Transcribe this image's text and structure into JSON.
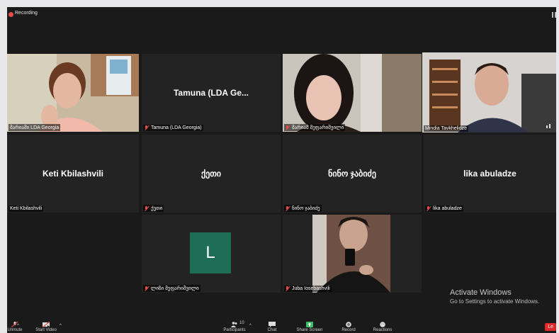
{
  "recording": {
    "label": "Recording"
  },
  "tiles": [
    {
      "id": "t1",
      "label": "მარიამი LDA Georgia",
      "muted": false
    },
    {
      "id": "t2",
      "center_name": "Tamuna  (LDA Ge...",
      "label": "Tamuna (LDA Georgia)",
      "muted": true
    },
    {
      "id": "t3",
      "label": "მარიამ მეფარიშვილი",
      "muted": true
    },
    {
      "id": "t4",
      "label": "Mindia Tavkhelidze",
      "muted": false,
      "active_speaker": true
    },
    {
      "id": "t5",
      "center_name": "Keti Kbilashvili",
      "label": "Keti Kbilashvili",
      "muted": false
    },
    {
      "id": "t6",
      "center_name": "ქეთი",
      "label": "ქეთი",
      "muted": true
    },
    {
      "id": "t7",
      "center_name": "ნინო ჯაბიძე",
      "label": "ნინო ჯაბიძე",
      "muted": true
    },
    {
      "id": "t8",
      "center_name": "lika abuladze",
      "label": "lika abuladze",
      "muted": true
    },
    {
      "id": "t9",
      "avatar_letter": "L",
      "label": "ლიზი მეფარიშვილი",
      "muted": true
    },
    {
      "id": "t10",
      "label": "Juba Iosebashvili",
      "muted": true
    }
  ],
  "toolbar": {
    "mute_label": "Unmute",
    "video_label": "Start Video",
    "participants_label": "Participants",
    "participants_count": "10",
    "chat_label": "Chat",
    "share_label": "Share Screen",
    "record_label": "Record",
    "reactions_label": "Reactions",
    "leave_label": "Le"
  },
  "watermark": {
    "title": "Activate Windows",
    "subtitle": "Go to Settings to activate Windows."
  },
  "colors": {
    "accent_active": "#b9e03a",
    "avatar_bg": "#1e6e56",
    "mute_red": "#e84b4b",
    "leave_red": "#e02828"
  }
}
